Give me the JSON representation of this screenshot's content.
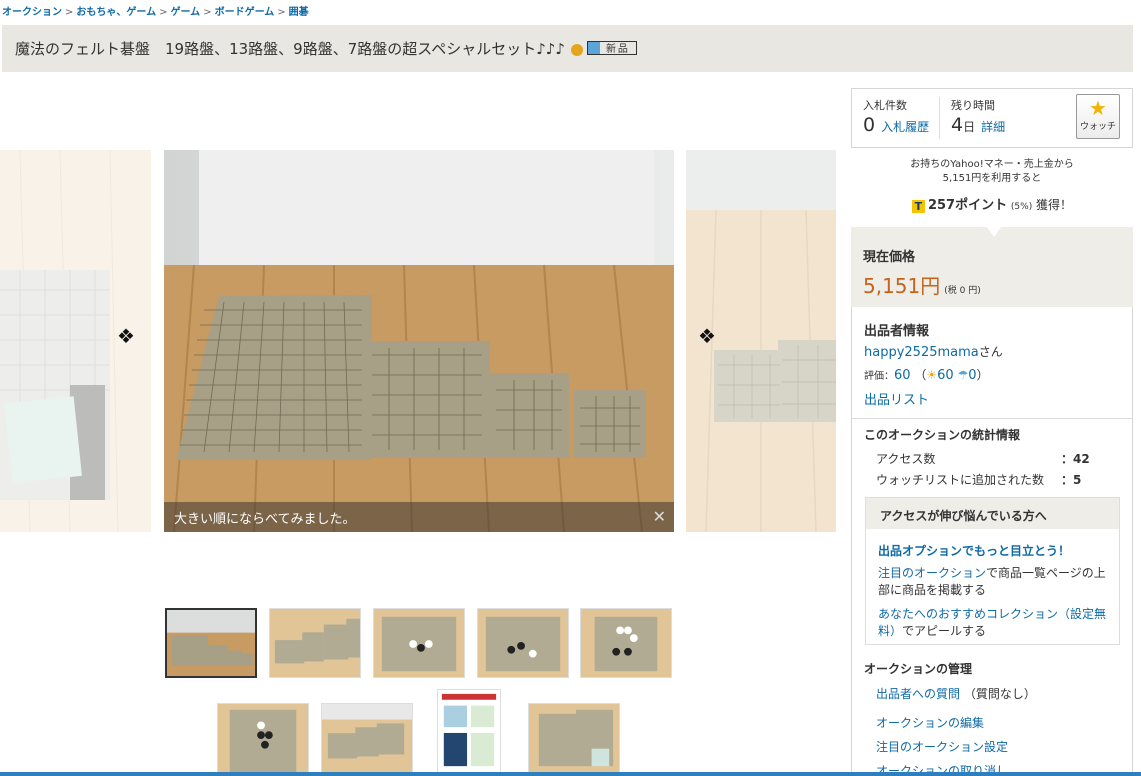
{
  "breadcrumb": [
    "オークション",
    "おもちゃ、ゲーム",
    "ゲーム",
    "ボードゲーム",
    "囲碁"
  ],
  "breadcrumb_sep": ">",
  "title": "魔法のフェルト碁盤　19路盤、13路盤、9路盤、7路盤の超スペシャルセット♪♪♪",
  "new_badge": "新品",
  "gallery": {
    "caption": "大きい順にならべてみました。",
    "close_glyph": "✕",
    "prev_glyph": "◆",
    "next_glyph": "◆"
  },
  "bid": {
    "count_label": "入札件数",
    "count": "0",
    "history_link": "入札履歴",
    "time_label": "残り時間",
    "time_value": "4",
    "time_unit": "日",
    "detail_link": "詳細"
  },
  "watch": {
    "label": "ウォッチ",
    "icon": "star-icon"
  },
  "money": {
    "line1": "お持ちのYahoo!マネー・売上金から",
    "line2": "5,151円を利用すると",
    "points": "257ポイント",
    "percent": "(5%)",
    "gain": "獲得！"
  },
  "price": {
    "label": "現在価格",
    "value": "5,151円",
    "tax": "(税 0 円)"
  },
  "seller": {
    "section_title": "出品者情報",
    "name": "happy2525mama",
    "san": "さん",
    "rating_label": "評価：",
    "rating": "60",
    "good": "60",
    "bad": "0",
    "list_link": "出品リスト"
  },
  "stats": {
    "section_title": "このオークションの統計情報",
    "rows": [
      {
        "label": "アクセス数",
        "value": "：42"
      },
      {
        "label": "ウォッチリストに追加された数",
        "value": "：5"
      }
    ]
  },
  "promo": {
    "head": "アクセスが伸び悩んでいる方へ",
    "cta": "出品オプションでもっと目立とう！",
    "item1_link": "注目のオークション",
    "item1_text": "で商品一覧ページの上部に商品を掲載する",
    "item2_link": "あなたへのおすすめコレクション（設定無料）",
    "item2_text": "でアピールする"
  },
  "management": {
    "section_title": "オークションの管理",
    "items": [
      {
        "link": "出品者への質問",
        "note": "（質問なし）"
      },
      {
        "link": "オークションの編集",
        "note": ""
      },
      {
        "link": "注目のオークション設定",
        "note": ""
      },
      {
        "link": "オークションの取り消し",
        "note": ""
      }
    ]
  }
}
